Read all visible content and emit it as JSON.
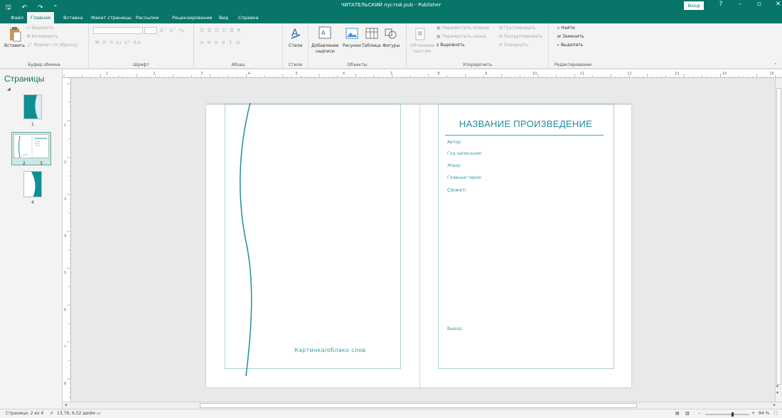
{
  "window": {
    "title": "ЧИТАТЕЛЬСКИЙ пустой.pub  -  Publisher",
    "signin": "Вход",
    "help": "?",
    "minimize": "–",
    "restore": "▫",
    "close": "✕"
  },
  "qat": {
    "save": "🖫",
    "undo": "↶",
    "redo": "↷",
    "more": "⁼"
  },
  "tabs": [
    "Файл",
    "Главная",
    "Вставка",
    "Макет страницы",
    "Рассылки",
    "Рецензирование",
    "Вид",
    "Справка"
  ],
  "ribbon": {
    "clipboard": {
      "label": "Буфер обмена",
      "paste": "Вставить",
      "cut": "Вырезать",
      "copy": "Копировать",
      "format_painter": "Формат по образцу"
    },
    "font": {
      "label": "Шрифт",
      "font_name": "",
      "font_size": "",
      "glyphs_row2": "Ж К Ч x₂ x² Aa",
      "glyphs_row1": "A˄ A˅ ⅍"
    },
    "paragraph": {
      "label": "Абзац",
      "glyphs_row1": "☰ ☰ ☷ ☷ ☰ ¶",
      "glyphs_row2": "≡ ≡ ≡ ≡ ↕ ⇲"
    },
    "styles": {
      "label": "Стили",
      "styles_btn": "Стили"
    },
    "objects": {
      "label": "Объекты",
      "textbox_line1": "Добавление",
      "textbox_line2": "надписи",
      "pictures": "Рисунки",
      "table": "Таблица",
      "shapes": "Фигуры"
    },
    "arrange": {
      "label": "Упорядочить",
      "wrap_line1": "Обтекание",
      "wrap_line2": "текстом",
      "bring_forward": "Переместить вперед",
      "send_backward": "Переместить назад",
      "align": "Выровнять",
      "group": "Группировать",
      "ungroup": "Разгруппировать",
      "rotate": "Повернуть"
    },
    "editing": {
      "label": "Редактирование",
      "find": "Найти",
      "replace": "Заменить",
      "select": "Выделить"
    }
  },
  "pages_pane": {
    "title": "Страницы",
    "page_numbers": [
      "1",
      "2",
      "3",
      "4"
    ]
  },
  "ruler": {
    "h_labels": [
      "1",
      "2",
      "3",
      "4",
      "5",
      "6",
      "7",
      "8",
      "9",
      "10",
      "11",
      "12",
      "13",
      "14",
      "15"
    ],
    "v_labels": [
      "1",
      "2",
      "3",
      "4",
      "5",
      "6",
      "7",
      "8"
    ]
  },
  "document": {
    "title": "НАЗВАНИЕ ПРОИЗВЕДЕНИЕ",
    "fields": {
      "author": "Автор:",
      "year": "Год написания:",
      "genre": "Жанр:",
      "heroes": "Главные герои:",
      "plot": "Сюжет:",
      "conclusion": "Вывод:"
    },
    "caption": "Картинка/облако слов"
  },
  "status": {
    "page": "Страница: 2 из 4",
    "position": "13,76; 6,52 дюйм",
    "zoom": "94 %",
    "zoom_level": 0.62
  },
  "colors": {
    "accent": "#077568",
    "doc_teal": "#1f8f98"
  }
}
